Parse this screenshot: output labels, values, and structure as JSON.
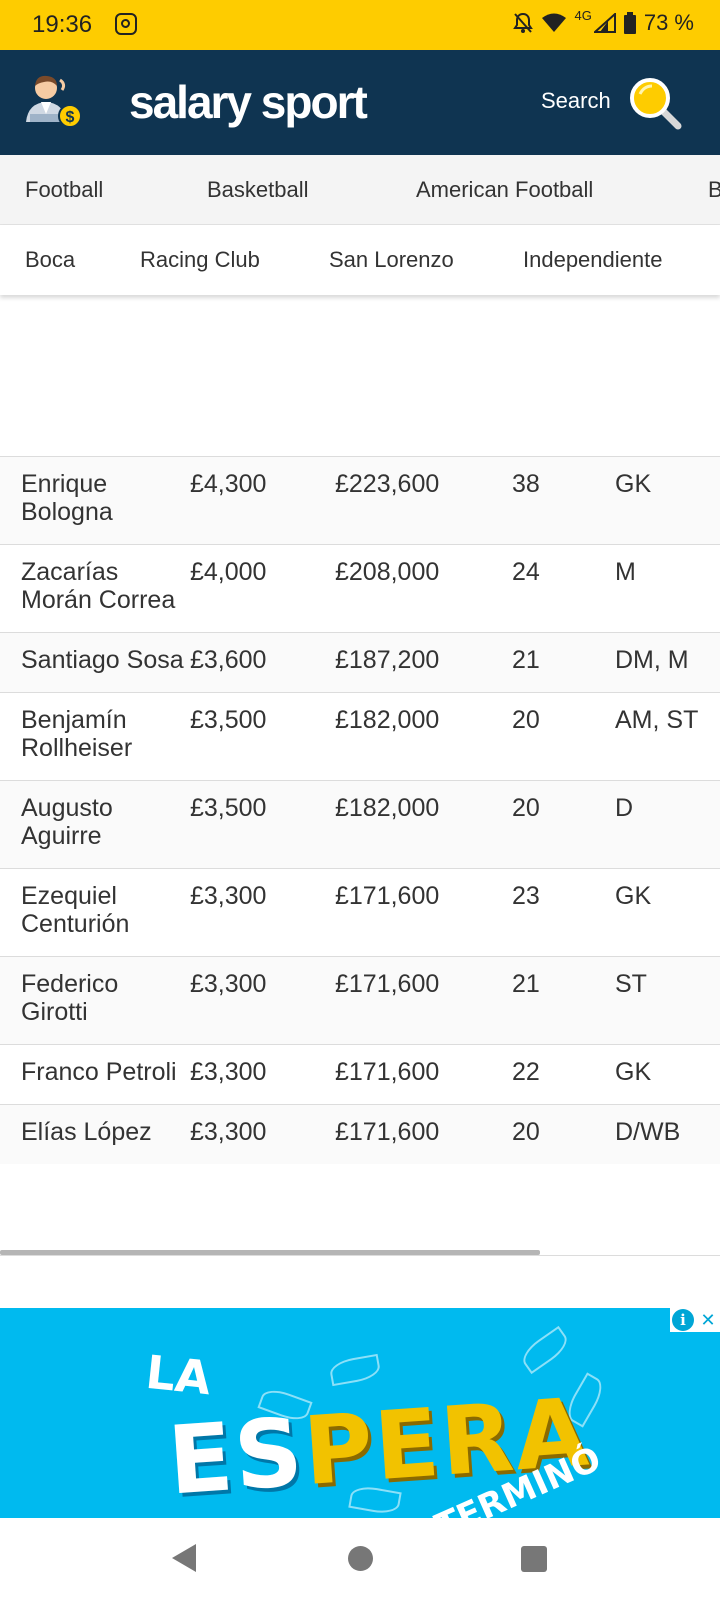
{
  "status_bar": {
    "time": "19:36",
    "network": "4G",
    "battery": "73 %",
    "icons": [
      "instagram-icon",
      "bell-off-icon",
      "wifi-icon",
      "signal-icon",
      "battery-icon"
    ]
  },
  "header": {
    "brand": "salary sport",
    "search_label": "Search",
    "colors": {
      "background": "#0f3451",
      "accent": "#fecc00"
    }
  },
  "nav_primary": {
    "items": [
      "Football",
      "Basketball",
      "American Football",
      "B"
    ]
  },
  "nav_secondary": {
    "items": [
      "Boca",
      "Racing Club",
      "San Lorenzo",
      "Independiente"
    ]
  },
  "table": {
    "rows": [
      {
        "name": "Enrique Bologna",
        "weekly": "£4,300",
        "yearly": "£223,600",
        "age": "38",
        "position": "GK"
      },
      {
        "name": "Zacarías Morán Correa",
        "weekly": "£4,000",
        "yearly": "£208,000",
        "age": "24",
        "position": "M"
      },
      {
        "name": "Santiago Sosa",
        "weekly": "£3,600",
        "yearly": "£187,200",
        "age": "21",
        "position": "DM, M"
      },
      {
        "name": "Benjamín Rollheiser",
        "weekly": "£3,500",
        "yearly": "£182,000",
        "age": "20",
        "position": "AM, ST"
      },
      {
        "name": "Augusto Aguirre",
        "weekly": "£3,500",
        "yearly": "£182,000",
        "age": "20",
        "position": "D"
      },
      {
        "name": "Ezequiel Centurión",
        "weekly": "£3,300",
        "yearly": "£171,600",
        "age": "23",
        "position": "GK"
      },
      {
        "name": "Federico Girotti",
        "weekly": "£3,300",
        "yearly": "£171,600",
        "age": "21",
        "position": "ST"
      },
      {
        "name": "Franco Petroli",
        "weekly": "£3,300",
        "yearly": "£171,600",
        "age": "22",
        "position": "GK"
      },
      {
        "name": "Elías López",
        "weekly": "£3,300",
        "yearly": "£171,600",
        "age": "20",
        "position": "D/WB"
      }
    ]
  },
  "ad": {
    "line1": "LA",
    "big_a": "ES",
    "big_b": "PERA",
    "line3": "TERMINÓ",
    "info_label": "i",
    "close_label": "✕"
  }
}
